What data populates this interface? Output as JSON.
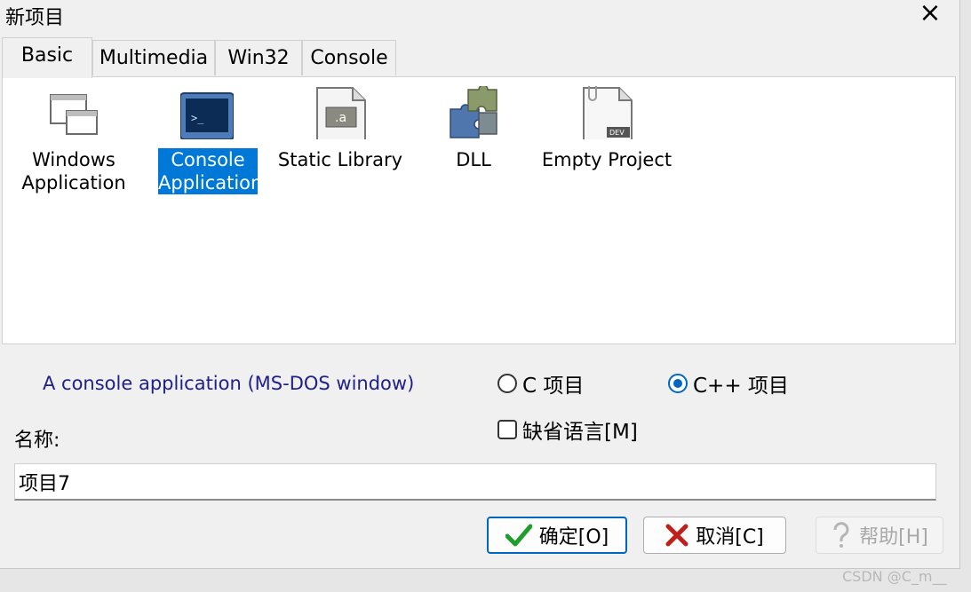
{
  "window": {
    "title": "新项目",
    "close_icon": "×"
  },
  "tabs": [
    {
      "label": "Basic",
      "active": true
    },
    {
      "label": "Multimedia",
      "active": false
    },
    {
      "label": "Win32",
      "active": false
    },
    {
      "label": "Console",
      "active": false
    }
  ],
  "templates": [
    {
      "line1": "Windows",
      "line2": "Application",
      "icon": "windows-app-icon",
      "selected": false
    },
    {
      "line1": "Console",
      "line2": "Application",
      "icon": "console-app-icon",
      "selected": true
    },
    {
      "line1": "Static Library",
      "line2": "",
      "icon": "static-library-icon",
      "selected": false
    },
    {
      "line1": "DLL",
      "line2": "",
      "icon": "dll-puzzle-icon",
      "selected": false
    },
    {
      "line1": "Empty Project",
      "line2": "",
      "icon": "empty-project-icon",
      "selected": false
    }
  ],
  "description": "A console application (MS-DOS window)",
  "language": {
    "c_label": "C 项目",
    "cpp_label": "C++ 项目",
    "selected": "C++ 项目",
    "default_lang_label": "缺省语言[M]",
    "default_lang_checked": false
  },
  "name": {
    "label": "名称:",
    "value": "项目7"
  },
  "buttons": {
    "ok": "确定[O]",
    "cancel": "取消[C]",
    "help": "帮助[H]"
  },
  "colors": {
    "selection": "#0078d7",
    "accent": "#0067c0",
    "description_text": "#20208a"
  },
  "watermark": "CSDN @C_m__"
}
